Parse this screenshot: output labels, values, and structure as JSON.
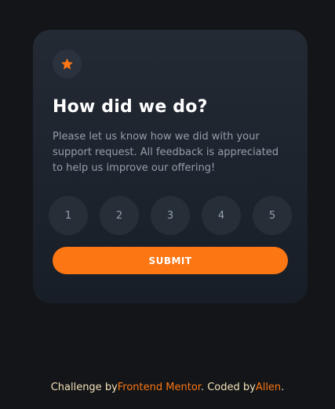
{
  "card": {
    "icon": "star-icon",
    "title": "How did we do?",
    "description": "Please let us know how we did with your support request. All feedback is appreciated to help us improve our offering!",
    "ratings": [
      "1",
      "2",
      "3",
      "4",
      "5"
    ],
    "submit_label": "SUBMIT"
  },
  "attribution": {
    "prefix": "Challenge by",
    "link1": "Frontend Mentor",
    "middle": ". Coded by",
    "link2": "Allen",
    "suffix": "."
  },
  "colors": {
    "background": "#131518",
    "card": "#1f2630",
    "accent": "#fc7614",
    "rating_bg": "#262e38",
    "text_muted": "#959eac",
    "attribution_text": "#f3e0b8"
  }
}
